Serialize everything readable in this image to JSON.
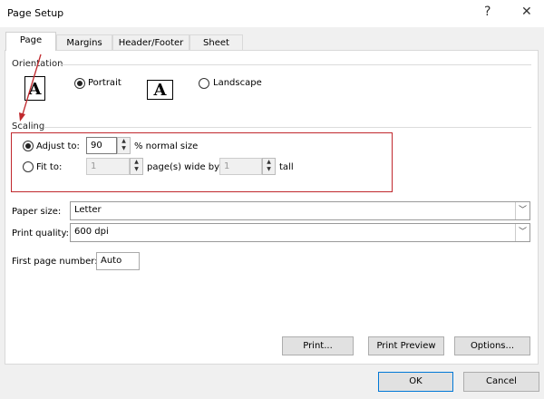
{
  "window": {
    "title": "Page Setup",
    "help": "?",
    "close": "✕"
  },
  "tabs": [
    {
      "label": "Page"
    },
    {
      "label": "Margins"
    },
    {
      "label": "Header/Footer"
    },
    {
      "label": "Sheet"
    }
  ],
  "orientation": {
    "label": "Orientation",
    "portrait": "Portrait",
    "landscape": "Landscape",
    "icon_letter": "A",
    "selected": "portrait"
  },
  "scaling": {
    "label": "Scaling",
    "adjust_label": "Adjust to:",
    "adjust_value": "90",
    "adjust_suffix": "% normal size",
    "fit_label": "Fit to:",
    "fit_wide": "1",
    "fit_wide_suffix": "page(s) wide by",
    "fit_tall": "1",
    "fit_tall_suffix": "tall",
    "highlight_color": "#c0282d"
  },
  "paper_size": {
    "label": "Paper size:",
    "value": "Letter"
  },
  "print_quality": {
    "label": "Print quality:",
    "value": "600 dpi"
  },
  "first_page": {
    "label": "First page number:",
    "value": "Auto"
  },
  "buttons": {
    "print": "Print...",
    "preview": "Print Preview",
    "options": "Options...",
    "ok": "OK",
    "cancel": "Cancel"
  }
}
